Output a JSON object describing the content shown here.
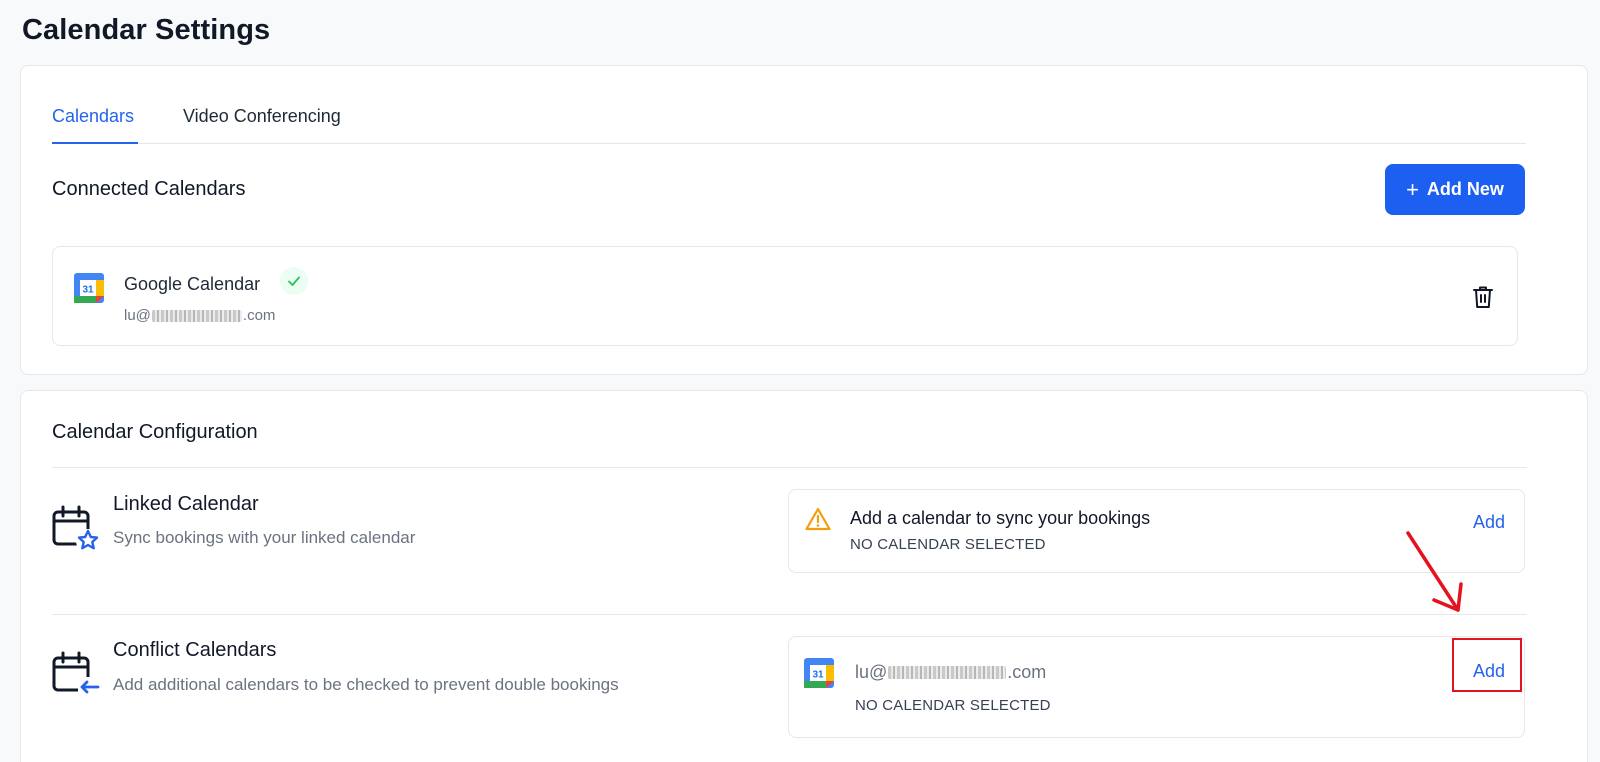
{
  "page": {
    "title": "Calendar Settings"
  },
  "tabs": [
    {
      "label": "Calendars",
      "active": true
    },
    {
      "label": "Video Conferencing",
      "active": false
    }
  ],
  "connected": {
    "title": "Connected Calendars",
    "add_new_label": "Add New",
    "item": {
      "name": "Google Calendar",
      "email_prefix": "lu@",
      "email_suffix": ".com",
      "icon": "google-calendar-icon",
      "date_number": "31"
    }
  },
  "config": {
    "title": "Calendar Configuration",
    "linked": {
      "title": "Linked Calendar",
      "subtitle": "Sync bookings with your linked calendar",
      "status_title": "Add a calendar to sync your bookings",
      "status_sub": "NO CALENDAR SELECTED",
      "add_label": "Add"
    },
    "conflict": {
      "title": "Conflict Calendars",
      "subtitle": "Add additional calendars to be checked to prevent double bookings",
      "email_prefix": "lu@",
      "email_suffix": ".com",
      "status_sub": "NO CALENDAR SELECTED",
      "add_label": "Add"
    }
  },
  "colors": {
    "accent": "#2563eb",
    "button": "#1d5ff0",
    "annotation": "#e5121f",
    "warning": "#f59e0b",
    "success": "#22c55e"
  }
}
